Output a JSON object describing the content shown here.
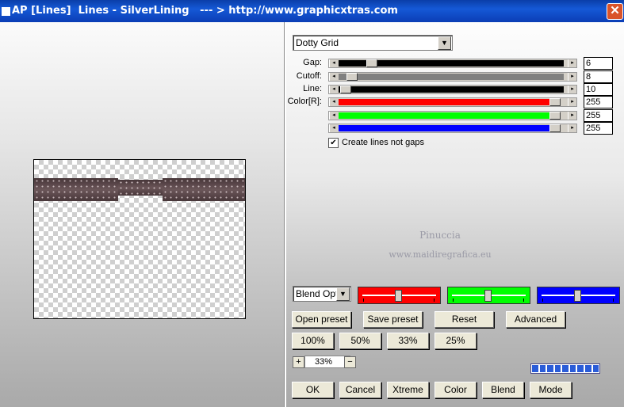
{
  "titlebar": {
    "title": "AP [Lines]  Lines - SilverLining   --- > http://www.graphicxtras.com",
    "close_glyph": "✕"
  },
  "preset_select": {
    "value": "Dotty Grid",
    "arrow": "▼"
  },
  "sliders": [
    {
      "label": "Gap:",
      "value": "6",
      "track_color": "#000000",
      "level": 0.06
    },
    {
      "label": "Cutoff:",
      "value": "8",
      "track_color": "#808080",
      "level": 0.03
    },
    {
      "label": "Line:",
      "value": "10",
      "track_color": "#000000",
      "level": 0.01
    },
    {
      "label": "Color[R]:",
      "value": "255",
      "track_color": "#ff0000",
      "level": 1.0
    },
    {
      "label": "",
      "value": "255",
      "track_color": "#00ff00",
      "level": 1.0
    },
    {
      "label": "",
      "value": "255",
      "track_color": "#0000ff",
      "level": 1.0
    }
  ],
  "slider_arrows": {
    "left": "◂",
    "right": "▸"
  },
  "checkbox": {
    "label": "Create lines not gaps",
    "checked": true,
    "mark": "✔"
  },
  "watermark": {
    "line1": "Pinuccia",
    "line2": "www.maidiregrafica.eu"
  },
  "blend_select": {
    "value": "Blend Optio",
    "arrow": "▼"
  },
  "color_sliders": [
    {
      "color": "#ff0000",
      "level": 0.5
    },
    {
      "color": "#00ff00",
      "level": 0.5
    },
    {
      "color": "#0000ff",
      "level": 0.5
    }
  ],
  "preset_buttons": [
    "Open preset",
    "Save preset",
    "Reset",
    "Advanced"
  ],
  "zoom_buttons": [
    "100%",
    "50%",
    "33%",
    "25%"
  ],
  "zoom": {
    "minus": "−",
    "plus": "+",
    "value": "33%"
  },
  "progress": {
    "segments": 9
  },
  "bottom_buttons": [
    "OK",
    "Cancel",
    "Xtreme",
    "Color",
    "Blend",
    "Mode"
  ]
}
